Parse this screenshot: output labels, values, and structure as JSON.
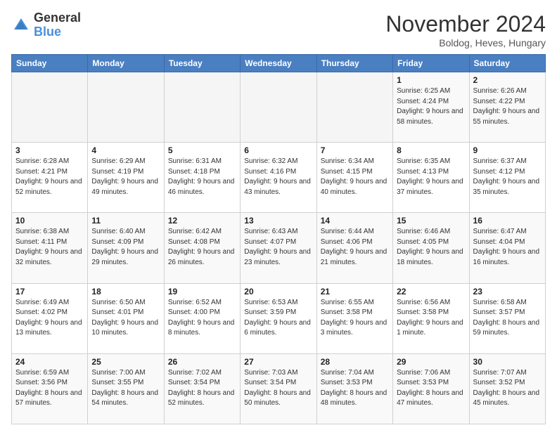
{
  "logo": {
    "general": "General",
    "blue": "Blue"
  },
  "header": {
    "month_title": "November 2024",
    "subtitle": "Boldog, Heves, Hungary"
  },
  "weekdays": [
    "Sunday",
    "Monday",
    "Tuesday",
    "Wednesday",
    "Thursday",
    "Friday",
    "Saturday"
  ],
  "weeks": [
    [
      {
        "day": "",
        "detail": ""
      },
      {
        "day": "",
        "detail": ""
      },
      {
        "day": "",
        "detail": ""
      },
      {
        "day": "",
        "detail": ""
      },
      {
        "day": "",
        "detail": ""
      },
      {
        "day": "1",
        "detail": "Sunrise: 6:25 AM\nSunset: 4:24 PM\nDaylight: 9 hours and 58 minutes."
      },
      {
        "day": "2",
        "detail": "Sunrise: 6:26 AM\nSunset: 4:22 PM\nDaylight: 9 hours and 55 minutes."
      }
    ],
    [
      {
        "day": "3",
        "detail": "Sunrise: 6:28 AM\nSunset: 4:21 PM\nDaylight: 9 hours and 52 minutes."
      },
      {
        "day": "4",
        "detail": "Sunrise: 6:29 AM\nSunset: 4:19 PM\nDaylight: 9 hours and 49 minutes."
      },
      {
        "day": "5",
        "detail": "Sunrise: 6:31 AM\nSunset: 4:18 PM\nDaylight: 9 hours and 46 minutes."
      },
      {
        "day": "6",
        "detail": "Sunrise: 6:32 AM\nSunset: 4:16 PM\nDaylight: 9 hours and 43 minutes."
      },
      {
        "day": "7",
        "detail": "Sunrise: 6:34 AM\nSunset: 4:15 PM\nDaylight: 9 hours and 40 minutes."
      },
      {
        "day": "8",
        "detail": "Sunrise: 6:35 AM\nSunset: 4:13 PM\nDaylight: 9 hours and 37 minutes."
      },
      {
        "day": "9",
        "detail": "Sunrise: 6:37 AM\nSunset: 4:12 PM\nDaylight: 9 hours and 35 minutes."
      }
    ],
    [
      {
        "day": "10",
        "detail": "Sunrise: 6:38 AM\nSunset: 4:11 PM\nDaylight: 9 hours and 32 minutes."
      },
      {
        "day": "11",
        "detail": "Sunrise: 6:40 AM\nSunset: 4:09 PM\nDaylight: 9 hours and 29 minutes."
      },
      {
        "day": "12",
        "detail": "Sunrise: 6:42 AM\nSunset: 4:08 PM\nDaylight: 9 hours and 26 minutes."
      },
      {
        "day": "13",
        "detail": "Sunrise: 6:43 AM\nSunset: 4:07 PM\nDaylight: 9 hours and 23 minutes."
      },
      {
        "day": "14",
        "detail": "Sunrise: 6:44 AM\nSunset: 4:06 PM\nDaylight: 9 hours and 21 minutes."
      },
      {
        "day": "15",
        "detail": "Sunrise: 6:46 AM\nSunset: 4:05 PM\nDaylight: 9 hours and 18 minutes."
      },
      {
        "day": "16",
        "detail": "Sunrise: 6:47 AM\nSunset: 4:04 PM\nDaylight: 9 hours and 16 minutes."
      }
    ],
    [
      {
        "day": "17",
        "detail": "Sunrise: 6:49 AM\nSunset: 4:02 PM\nDaylight: 9 hours and 13 minutes."
      },
      {
        "day": "18",
        "detail": "Sunrise: 6:50 AM\nSunset: 4:01 PM\nDaylight: 9 hours and 10 minutes."
      },
      {
        "day": "19",
        "detail": "Sunrise: 6:52 AM\nSunset: 4:00 PM\nDaylight: 9 hours and 8 minutes."
      },
      {
        "day": "20",
        "detail": "Sunrise: 6:53 AM\nSunset: 3:59 PM\nDaylight: 9 hours and 6 minutes."
      },
      {
        "day": "21",
        "detail": "Sunrise: 6:55 AM\nSunset: 3:58 PM\nDaylight: 9 hours and 3 minutes."
      },
      {
        "day": "22",
        "detail": "Sunrise: 6:56 AM\nSunset: 3:58 PM\nDaylight: 9 hours and 1 minute."
      },
      {
        "day": "23",
        "detail": "Sunrise: 6:58 AM\nSunset: 3:57 PM\nDaylight: 8 hours and 59 minutes."
      }
    ],
    [
      {
        "day": "24",
        "detail": "Sunrise: 6:59 AM\nSunset: 3:56 PM\nDaylight: 8 hours and 57 minutes."
      },
      {
        "day": "25",
        "detail": "Sunrise: 7:00 AM\nSunset: 3:55 PM\nDaylight: 8 hours and 54 minutes."
      },
      {
        "day": "26",
        "detail": "Sunrise: 7:02 AM\nSunset: 3:54 PM\nDaylight: 8 hours and 52 minutes."
      },
      {
        "day": "27",
        "detail": "Sunrise: 7:03 AM\nSunset: 3:54 PM\nDaylight: 8 hours and 50 minutes."
      },
      {
        "day": "28",
        "detail": "Sunrise: 7:04 AM\nSunset: 3:53 PM\nDaylight: 8 hours and 48 minutes."
      },
      {
        "day": "29",
        "detail": "Sunrise: 7:06 AM\nSunset: 3:53 PM\nDaylight: 8 hours and 47 minutes."
      },
      {
        "day": "30",
        "detail": "Sunrise: 7:07 AM\nSunset: 3:52 PM\nDaylight: 8 hours and 45 minutes."
      }
    ]
  ]
}
